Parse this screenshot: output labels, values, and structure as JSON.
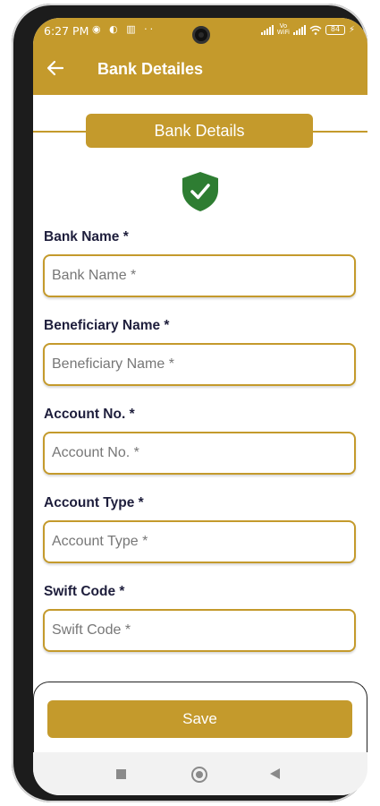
{
  "status_bar": {
    "time": "6:27 PM",
    "left_icons": "◉ ◐ ▥ ··",
    "vowifi": "Vo\nWiFi",
    "battery": "84"
  },
  "app_bar": {
    "title": "Bank Detailes"
  },
  "section": {
    "title": "Bank Details",
    "icon": "shield-check-icon"
  },
  "form": {
    "fields": [
      {
        "label": "Bank Name *",
        "placeholder": "Bank Name *",
        "value": ""
      },
      {
        "label": "Beneficiary Name *",
        "placeholder": "Beneficiary Name *",
        "value": ""
      },
      {
        "label": "Account No. *",
        "placeholder": "Account No. *",
        "value": ""
      },
      {
        "label": "Account Type *",
        "placeholder": "Account Type *",
        "value": ""
      },
      {
        "label": "Swift Code *",
        "placeholder": "Swift Code *",
        "value": ""
      }
    ],
    "save_label": "Save"
  },
  "colors": {
    "accent": "#c49a2c",
    "label_text": "#1e1e3c",
    "shield": "#2e7d32"
  }
}
